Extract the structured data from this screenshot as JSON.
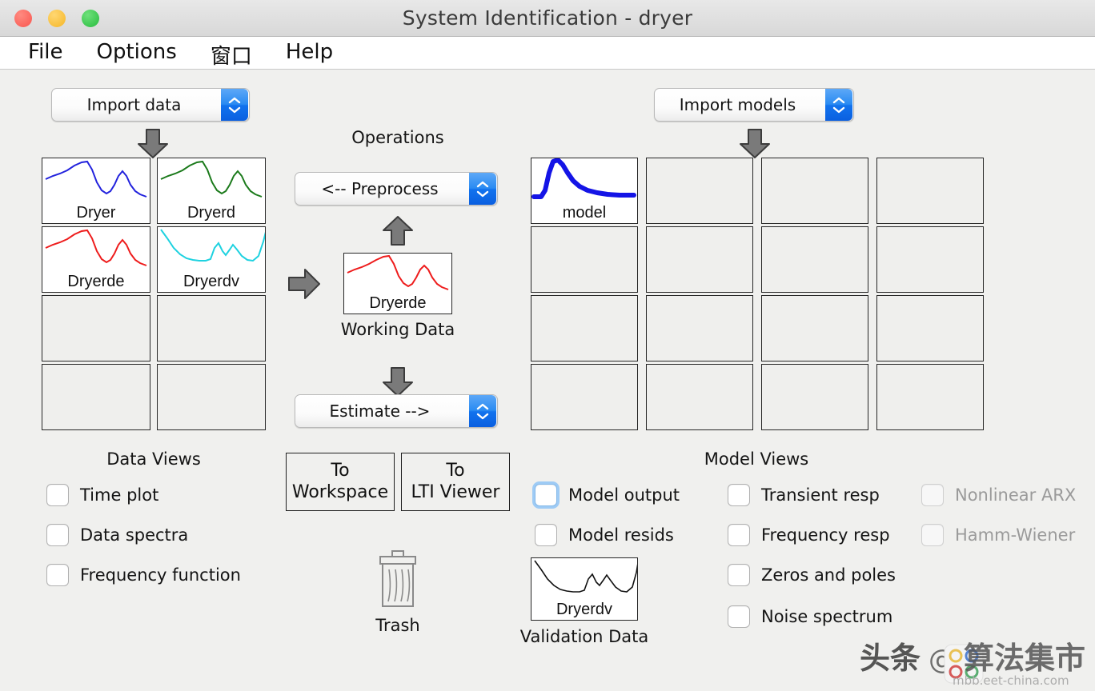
{
  "window": {
    "title": "System Identification - dryer",
    "traffic_lights": [
      "close",
      "minimize",
      "zoom"
    ],
    "colors": {
      "close": "#f9564f",
      "minimize": "#f5b627",
      "zoom": "#28bc3e",
      "accent_blue": "#1273ee",
      "focus_ring": "#9ecbf5",
      "background": "#f0f0ee"
    }
  },
  "menu": {
    "items": [
      {
        "label": "File"
      },
      {
        "label": "Options"
      },
      {
        "label": "窗口"
      },
      {
        "label": "Help"
      }
    ]
  },
  "data_panel": {
    "import_popup": {
      "label": "Import data"
    },
    "grid": {
      "columns": 2,
      "rows": 4,
      "cells": [
        {
          "name": "Dryer",
          "color": "#2222dd",
          "filled": true
        },
        {
          "name": "Dryerd",
          "color": "#1b7a1b",
          "filled": true
        },
        {
          "name": "Dryerde",
          "color": "#ee1c1c",
          "filled": true
        },
        {
          "name": "Dryerdv",
          "color": "#1fd2e0",
          "filled": true
        },
        {
          "name": "",
          "color": "",
          "filled": false
        },
        {
          "name": "",
          "color": "",
          "filled": false
        },
        {
          "name": "",
          "color": "",
          "filled": false
        },
        {
          "name": "",
          "color": "",
          "filled": false
        }
      ]
    },
    "views_heading": "Data Views",
    "views": [
      {
        "label": "Time plot",
        "checked": false,
        "disabled": false
      },
      {
        "label": "Data spectra",
        "checked": false,
        "disabled": false
      },
      {
        "label": "Frequency function",
        "checked": false,
        "disabled": false
      }
    ]
  },
  "operations": {
    "heading": "Operations",
    "preprocess_popup": {
      "label": "<-- Preprocess"
    },
    "estimate_popup": {
      "label": "Estimate -->"
    },
    "working_data": {
      "name": "Dryerde",
      "caption": "Working Data",
      "color": "#ee1c1c"
    },
    "buttons": [
      {
        "line1": "To",
        "line2": "Workspace"
      },
      {
        "line1": "To",
        "line2": "LTI Viewer"
      }
    ],
    "trash": {
      "label": "Trash",
      "icon": "trash-icon"
    }
  },
  "model_panel": {
    "import_popup": {
      "label": "Import models"
    },
    "grid": {
      "columns": 4,
      "rows": 4,
      "cells": [
        {
          "name": "model",
          "color": "#1414e6",
          "filled": true
        },
        {
          "name": "",
          "color": "",
          "filled": false
        },
        {
          "name": "",
          "color": "",
          "filled": false
        },
        {
          "name": "",
          "color": "",
          "filled": false
        },
        {
          "name": "",
          "color": "",
          "filled": false
        },
        {
          "name": "",
          "color": "",
          "filled": false
        },
        {
          "name": "",
          "color": "",
          "filled": false
        },
        {
          "name": "",
          "color": "",
          "filled": false
        },
        {
          "name": "",
          "color": "",
          "filled": false
        },
        {
          "name": "",
          "color": "",
          "filled": false
        },
        {
          "name": "",
          "color": "",
          "filled": false
        },
        {
          "name": "",
          "color": "",
          "filled": false
        },
        {
          "name": "",
          "color": "",
          "filled": false
        },
        {
          "name": "",
          "color": "",
          "filled": false
        },
        {
          "name": "",
          "color": "",
          "filled": false
        },
        {
          "name": "",
          "color": "",
          "filled": false
        }
      ]
    },
    "views_heading": "Model Views",
    "views_col1": [
      {
        "label": "Model output",
        "checked": false,
        "disabled": false,
        "focused": true
      },
      {
        "label": "Model resids",
        "checked": false,
        "disabled": false,
        "focused": false
      }
    ],
    "views_col2": [
      {
        "label": "Transient resp",
        "checked": false,
        "disabled": false
      },
      {
        "label": "Frequency resp",
        "checked": false,
        "disabled": false
      },
      {
        "label": "Zeros and poles",
        "checked": false,
        "disabled": false
      },
      {
        "label": "Noise spectrum",
        "checked": false,
        "disabled": false
      }
    ],
    "views_col3": [
      {
        "label": "Nonlinear ARX",
        "checked": false,
        "disabled": true
      },
      {
        "label": "Hamm-Wiener",
        "checked": false,
        "disabled": true
      }
    ],
    "validation_data": {
      "name": "Dryerdv",
      "caption": "Validation Data",
      "color": "#111111"
    }
  },
  "watermark": {
    "text_left": "头条",
    "text_right": "算法集市",
    "at_symbol": "@",
    "url": "mbb.eet-china.com"
  }
}
